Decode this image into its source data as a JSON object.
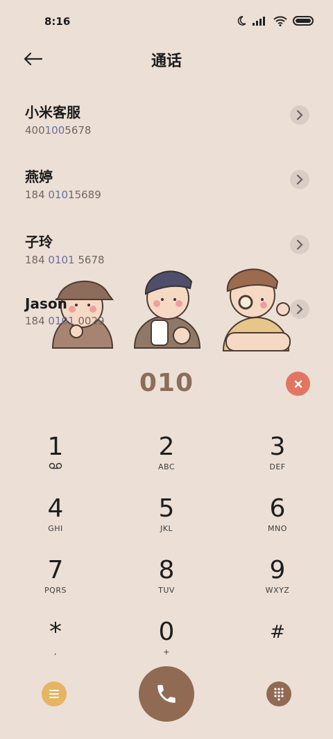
{
  "status_bar": {
    "time": "8:16"
  },
  "header": {
    "title": "通话"
  },
  "contacts": [
    {
      "name": "小米客服",
      "number_pre": "400",
      "number_hl": "100",
      "number_post": "5678"
    },
    {
      "name": "燕婷",
      "number_pre": "184 ",
      "number_hl": "010",
      "number_post": "15689"
    },
    {
      "name": "子玲",
      "number_pre": "184 ",
      "number_hl": "0101",
      "number_post": " 5678"
    },
    {
      "name": "Jason",
      "number_pre": "184 ",
      "number_hl": "0101",
      "number_post": " 0029"
    }
  ],
  "dialpad_input": {
    "value": "010"
  },
  "keys": [
    {
      "digit": "1",
      "sub": ""
    },
    {
      "digit": "2",
      "sub": "ABC"
    },
    {
      "digit": "3",
      "sub": "DEF"
    },
    {
      "digit": "4",
      "sub": "GHI"
    },
    {
      "digit": "5",
      "sub": "JKL"
    },
    {
      "digit": "6",
      "sub": "MNO"
    },
    {
      "digit": "7",
      "sub": "PQRS"
    },
    {
      "digit": "8",
      "sub": "TUV"
    },
    {
      "digit": "9",
      "sub": "WXYZ"
    },
    {
      "digit": "*",
      "sub": ","
    },
    {
      "digit": "0",
      "sub": "+"
    },
    {
      "digit": "#",
      "sub": ""
    }
  ],
  "colors": {
    "background": "#ecdfd6",
    "accent_brown": "#916a54",
    "clear_red": "#e27663",
    "menu_yellow": "#e6b463"
  },
  "icons": {
    "back": "arrow-left-icon",
    "chevron": "chevron-right-icon",
    "clear": "close-icon",
    "menu": "menu-icon",
    "call": "phone-icon",
    "keypad": "dialpad-icon",
    "voicemail": "voicemail-icon"
  }
}
